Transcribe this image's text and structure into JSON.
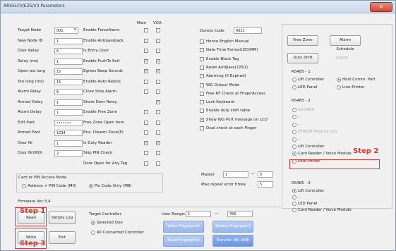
{
  "window": {
    "title": "ARSELFV/EZE/V3 Parameters",
    "close_symbol": "✕"
  },
  "col_headers": {
    "main": "Main",
    "vga": "VGA"
  },
  "left_fields": [
    {
      "label": "Target Node",
      "value": "001"
    },
    {
      "label": "New Node ID",
      "value": "1"
    },
    {
      "label": "Door Relay",
      "value": "6"
    },
    {
      "label": "Relay (ms)",
      "value": "1"
    },
    {
      "label": "Open too long",
      "value": "15"
    },
    {
      "label": "Too long (ms)",
      "value": "15"
    },
    {
      "label": "Alarm Relay",
      "value": "6"
    },
    {
      "label": "Armed Delay",
      "value": "1"
    },
    {
      "label": "Alarm Delay",
      "value": "1"
    },
    {
      "label": "Edit Pwd",
      "value": "•••••••"
    },
    {
      "label": "Armed Pwd",
      "value": "1234"
    },
    {
      "label": "Door Nr",
      "value": "1"
    },
    {
      "label": "Door Nr(WO)",
      "value": "2"
    }
  ],
  "middle_options": [
    {
      "label": "Enable ForceAlarm",
      "main": false,
      "vga": false
    },
    {
      "label": "Enable Antipassback",
      "main": false,
      "vga": false
    },
    {
      "label": "Is Entry Door",
      "main": false,
      "vga": false
    },
    {
      "label": "Enable PushTo Exit",
      "main": true,
      "vga": true
    },
    {
      "label": "Egress Beep Sounds",
      "main": true,
      "vga": true
    },
    {
      "label": "Enable Auto Relock",
      "main": false,
      "vga": false
    },
    {
      "label": "Close Stop Alarm",
      "main": false,
      "vga": false
    },
    {
      "label": "Share Door Relay",
      "main": null,
      "vga": true
    },
    {
      "label": "Enable Free Zone",
      "main": false,
      "vga": false
    },
    {
      "label": "Free Zone Open Item",
      "main": false,
      "vga": false
    },
    {
      "label": "Ena. Disarm Zone(E)",
      "main": false,
      "vga": false
    },
    {
      "label": "Is Duty Reader",
      "main": true,
      "vga": true
    },
    {
      "label": "Skip PIN Check",
      "main": false,
      "vga": false
    },
    {
      "label": "Door Open for Any Tag",
      "main": false,
      "vga": false
    }
  ],
  "duress": {
    "label": "Duress Code",
    "value": "4321"
  },
  "right_checks": [
    {
      "label": "Hence English Manual",
      "checked": false
    },
    {
      "label": "Date Time Format(DD/MM)",
      "checked": false
    },
    {
      "label": "Enable Black Tag",
      "checked": false
    },
    {
      "label": "Reset Antipass(7Z61)",
      "checked": false
    },
    {
      "label": "Alarming (if Expired)",
      "checked": false
    },
    {
      "label": "WG Output Mode",
      "checked": false
    },
    {
      "label": "Free RF Check at FingerAccess",
      "checked": false
    },
    {
      "label": "Lock Keyboard",
      "checked": false
    },
    {
      "label": "Enable duty shift table",
      "checked": false
    },
    {
      "label": "Show WG Port message on LCD",
      "checked": true
    },
    {
      "label": "Dual check at each Finger",
      "checked": false
    }
  ],
  "master": {
    "label": "Master",
    "from": "1",
    "dash": "—",
    "to": "0"
  },
  "max_repeat": {
    "label": "Max repeat error times",
    "value": "5"
  },
  "right_panel": {
    "free_zone_btn": "Free Zone",
    "alarm_schedule_btn": "Alarm Schedule",
    "duty_shift_btn": "Duty Shift",
    "duty_shift_value": "7Z6Z0",
    "rs485_1": {
      "title": "RS485 - 1",
      "opt1": "Lift Controller",
      "opt2": "Host Comm. Port",
      "opt3": "LED Panel",
      "opt4": "Line Printer"
    },
    "rs485_2": {
      "title": "RS485 - 2",
      "items": [
        "10-5000",
        "--",
        "--",
        "FP0008 Product Info",
        "--",
        "Lift Controller",
        "Card Reader / Voice Module",
        "Line Printer"
      ]
    },
    "rs485_3": {
      "title": "RS485 - 3",
      "items": [
        "Lift Controller",
        "--",
        "LED Panel",
        "Card Reader / Voice Module"
      ]
    }
  },
  "card_pin_mode": {
    "title": "Card or PIN Access Mode",
    "opt1": "Address + PIN Code (M0)",
    "opt2": "Pin Code Only (M8)"
  },
  "firmware": {
    "label": "Firmware Ver:3.4"
  },
  "bottom": {
    "read_btn": "Read",
    "simply_log_btn": "Simply Log",
    "write_btn": "Write",
    "exit_btn": "Exit",
    "target_controller": "Target Controller",
    "selected_one": "Selected One",
    "all_connected": "All Connected Controller",
    "user_range_label": "User Range:",
    "user_from": "1",
    "user_dash": "—",
    "user_to": "456",
    "write_fp_btn": "Write Fingerprint",
    "delete_fp_btn": "Delete Fingerprint",
    "read_fp_btn": "Read Fingerprint",
    "transfer_btn": "Transfer (W→WB)"
  },
  "annotations": {
    "step1": "Step 1",
    "step2": "Step 2",
    "step3": "Step 3"
  }
}
